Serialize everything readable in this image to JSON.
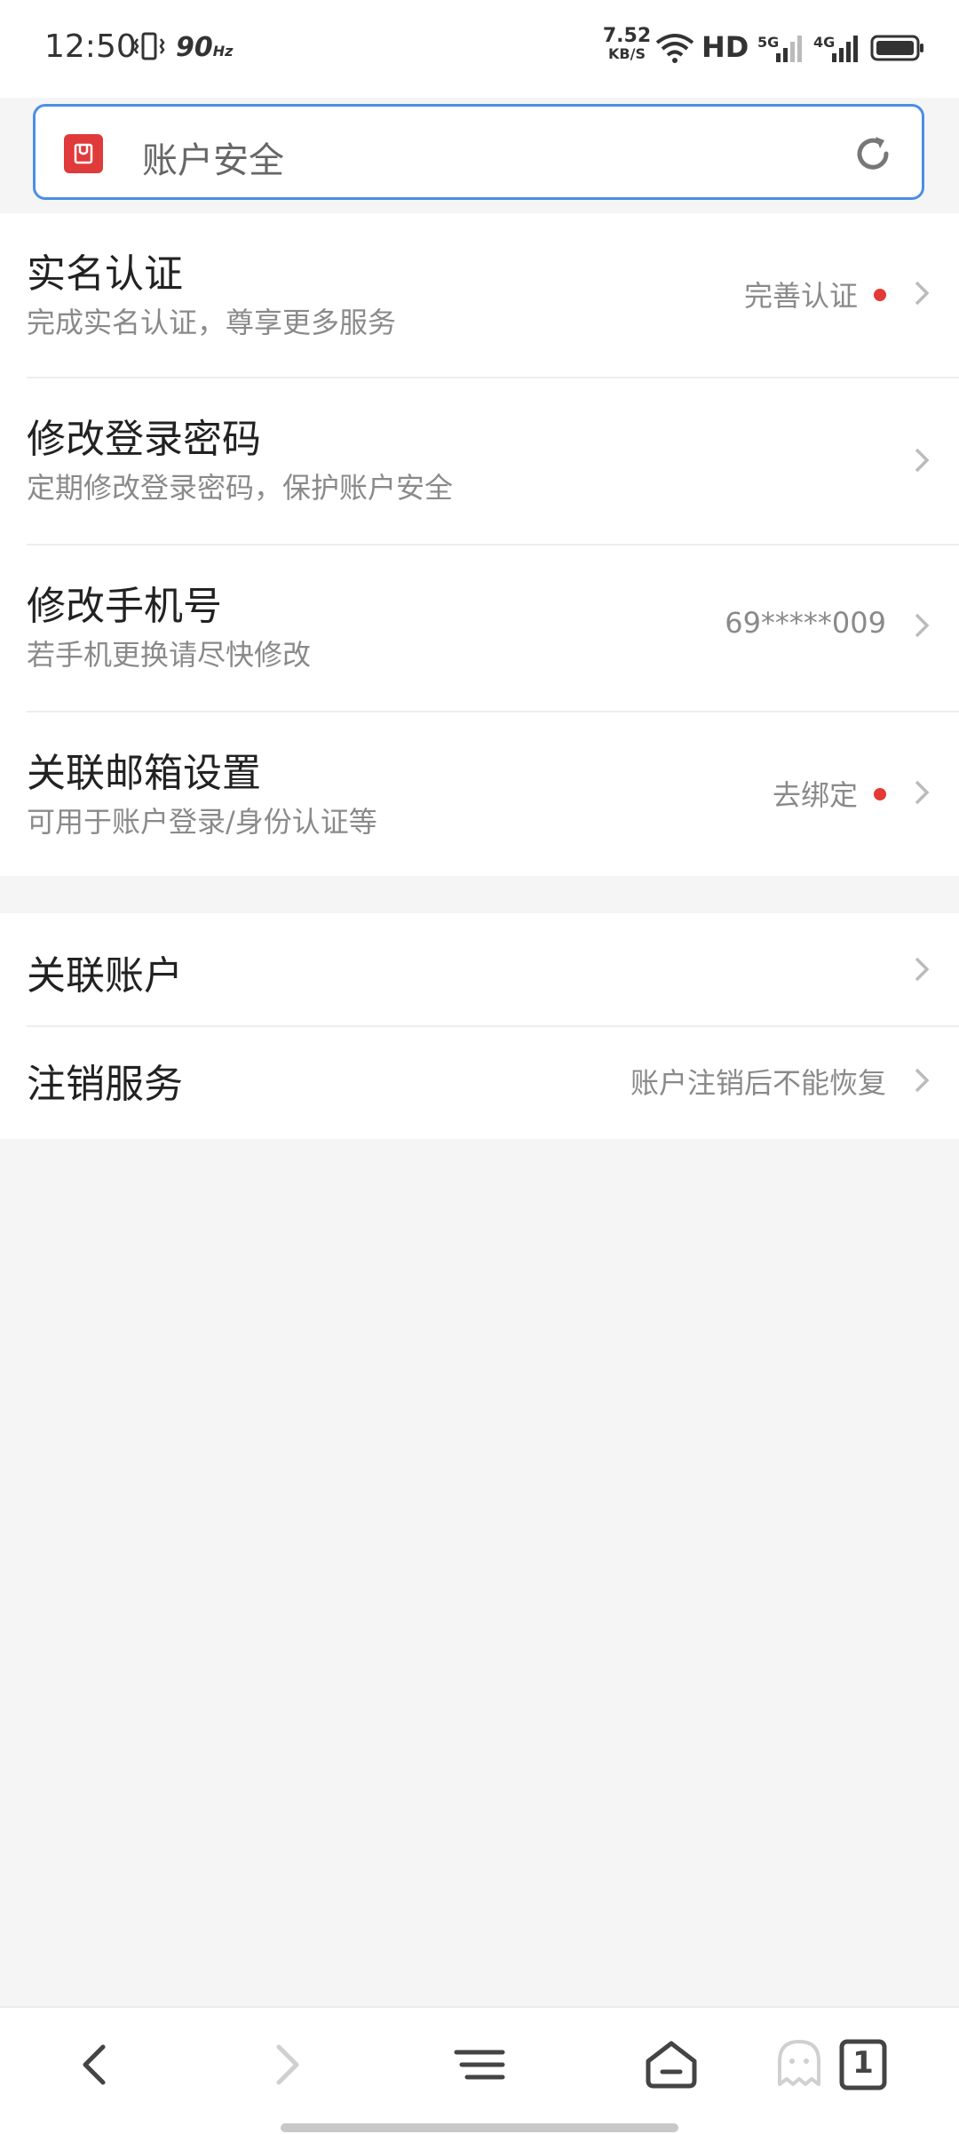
{
  "status_bar": {
    "time": "12:50",
    "refresh_rate": "90",
    "refresh_unit": "Hz",
    "net_speed_value": "7.52",
    "net_speed_unit": "KB/S",
    "hd_label": "HD",
    "network_1": "5G",
    "network_2": "4G"
  },
  "address_bar": {
    "page_title": "账户安全",
    "logo_icon": "browser-logo-icon",
    "reload_icon": "reload-icon"
  },
  "security_items": [
    {
      "title": "实名认证",
      "subtitle": "完成实名认证，尊享更多服务",
      "status": "完善认证",
      "has_dot": true
    },
    {
      "title": "修改登录密码",
      "subtitle": "定期修改登录密码，保护账户安全",
      "status": "",
      "has_dot": false
    },
    {
      "title": "修改手机号",
      "subtitle": "若手机更换请尽快修改",
      "status": "69*****009",
      "has_dot": false
    },
    {
      "title": "关联邮箱设置",
      "subtitle": "可用于账户登录/身份认证等",
      "status": "去绑定",
      "has_dot": true
    }
  ],
  "account_items": [
    {
      "title": "关联账户",
      "status": ""
    },
    {
      "title": "注销服务",
      "status": "账户注销后不能恢复"
    }
  ],
  "bottom_nav": {
    "tab_count": "1",
    "icons": [
      "back-icon",
      "forward-icon",
      "menu-icon",
      "home-icon",
      "incognito-icon",
      "tabs-icon"
    ]
  },
  "colors": {
    "accent": "#4a90e2",
    "alert_dot": "#e53935",
    "logo_red": "#e03a3a",
    "background": "#f5f5f5"
  }
}
